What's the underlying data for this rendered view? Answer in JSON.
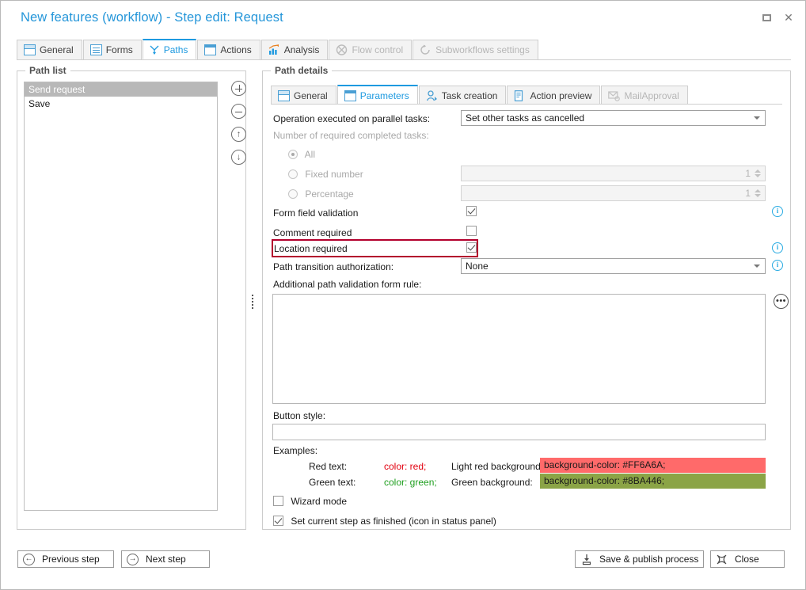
{
  "window": {
    "title": "New features (workflow) - Step edit: Request",
    "maximize_icon": "maximize-icon",
    "close_icon": "close-icon",
    "accent_color": "#2596d9"
  },
  "main_tabs": [
    {
      "label": "General",
      "icon": "window-icon",
      "state": "normal"
    },
    {
      "label": "Forms",
      "icon": "form-icon",
      "state": "normal"
    },
    {
      "label": "Paths",
      "icon": "paths-icon",
      "state": "active"
    },
    {
      "label": "Actions",
      "icon": "actions-icon",
      "state": "normal"
    },
    {
      "label": "Analysis",
      "icon": "analysis-icon",
      "state": "normal"
    },
    {
      "label": "Flow control",
      "icon": "flow-icon",
      "state": "disabled"
    },
    {
      "label": "Subworkflows settings",
      "icon": "subflow-icon",
      "state": "disabled"
    }
  ],
  "path_list": {
    "group_title": "Path list",
    "items": [
      {
        "label": "Send request",
        "selected": true
      },
      {
        "label": "Save",
        "selected": false
      }
    ],
    "buttons": [
      {
        "name": "add-path-button",
        "icon": "plus-icon"
      },
      {
        "name": "remove-path-button",
        "icon": "minus-icon"
      },
      {
        "name": "move-path-up-button",
        "icon": "arrow-up-icon"
      },
      {
        "name": "move-path-down-button",
        "icon": "arrow-down-icon"
      }
    ]
  },
  "path_details": {
    "group_title": "Path details",
    "tabs": [
      {
        "label": "General",
        "icon": "window-icon",
        "state": "normal"
      },
      {
        "label": "Parameters",
        "icon": "console-icon",
        "state": "active"
      },
      {
        "label": "Task creation",
        "icon": "user-task-icon",
        "state": "normal"
      },
      {
        "label": "Action preview",
        "icon": "document-icon",
        "state": "normal"
      },
      {
        "label": "MailApproval",
        "icon": "mail-icon",
        "state": "disabled"
      }
    ],
    "parameters": {
      "operation_label": "Operation executed on parallel tasks:",
      "operation_value": "Set other tasks as cancelled",
      "required_completed_label": "Number of required completed tasks:",
      "radios": [
        {
          "label": "All",
          "checked": true,
          "disabled": true
        },
        {
          "label": "Fixed number",
          "checked": false,
          "disabled": true
        },
        {
          "label": "Percentage",
          "checked": false,
          "disabled": true
        }
      ],
      "fixed_number_value": "1",
      "percentage_value": "1",
      "checkboxes": [
        {
          "label": "Form field validation",
          "checked": true,
          "info": true,
          "highlighted": false
        },
        {
          "label": "Comment required",
          "checked": false,
          "info": false,
          "highlighted": false
        },
        {
          "label": "Location required",
          "checked": true,
          "info": true,
          "highlighted": true
        }
      ],
      "highlight_color": "#b3002d",
      "authorization_label": "Path transition authorization:",
      "authorization_value": "None",
      "authorization_info": true,
      "validation_rule_label": "Additional path validation form rule:",
      "validation_rule_value": "",
      "ellipsis_button_label": "•••",
      "button_style_label": "Button style:",
      "button_style_value": "",
      "examples_label": "Examples:",
      "examples": [
        {
          "left_label": "Red text:",
          "left_code": "color: red;",
          "left_code_color": "#e2000f",
          "right_label": "Light red background:",
          "right_code": "background-color: #FF6A6A;",
          "right_bg": "#FF6A6A"
        },
        {
          "left_label": "Green text:",
          "left_code": "color: green;",
          "left_code_color": "#1f9f1f",
          "right_label": "Green background:",
          "right_code": "background-color: #8BA446;",
          "right_bg": "#8BA446"
        }
      ],
      "wizard_mode": {
        "label": "Wizard mode",
        "checked": false
      },
      "set_finished": {
        "label": "Set current step as finished (icon in status panel)",
        "checked": true
      }
    }
  },
  "footer": {
    "previous_step": {
      "label": "Previous step",
      "icon": "arrow-left-circle-icon"
    },
    "next_step": {
      "label": "Next step",
      "icon": "arrow-right-circle-icon"
    },
    "save_publish": {
      "label": "Save & publish process",
      "icon": "save-icon"
    },
    "close": {
      "label": "Close",
      "icon": "close-x-icon"
    }
  }
}
